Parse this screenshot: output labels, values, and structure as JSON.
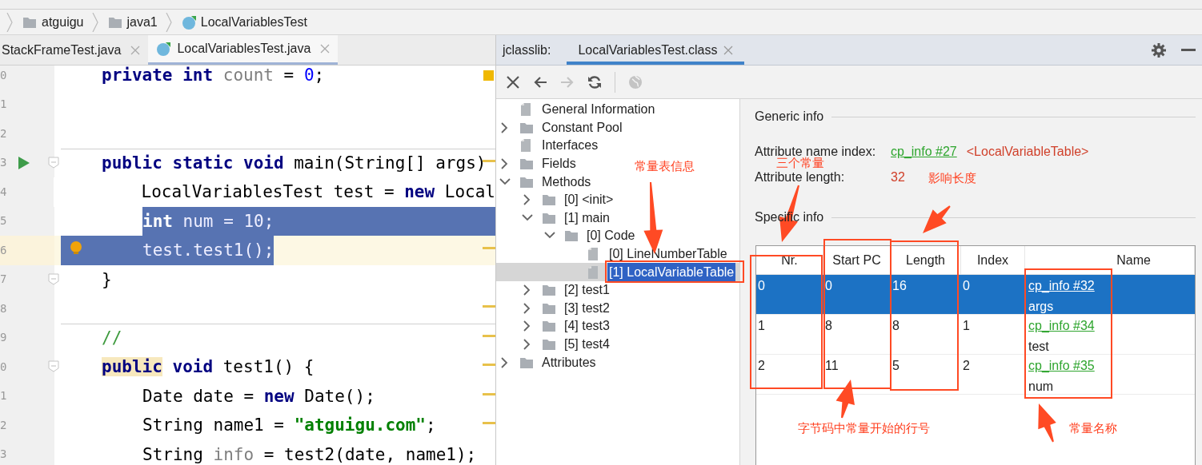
{
  "breadcrumbs": [
    {
      "label": "atguigu",
      "kind": "folder"
    },
    {
      "label": "java1",
      "kind": "folder"
    },
    {
      "label": "LocalVariablesTest",
      "kind": "class"
    }
  ],
  "editor_tabs": [
    {
      "label": "StackFrameTest.java",
      "selected": false
    },
    {
      "label": "LocalVariablesTest.java",
      "selected": true
    }
  ],
  "editor": {
    "lines": [
      {
        "number": "0",
        "kind": "top",
        "mark": false,
        "tokens": [
          {
            "text": "private",
            "kind": "kw"
          },
          {
            "text": " int",
            "kind": "kw"
          },
          {
            "text": " count",
            "kind": "field"
          },
          {
            "text": " = ",
            "kind": "plain"
          },
          {
            "text": "0",
            "kind": "num"
          },
          {
            "text": ";",
            "kind": "plain"
          }
        ]
      },
      {
        "number": "1",
        "kind": "blank",
        "mark": false
      },
      {
        "number": "2",
        "kind": "blank",
        "mark": false
      },
      {
        "number": "3",
        "kind": "top",
        "separator": true,
        "run": true,
        "fold": true,
        "mark": true,
        "tokens": [
          {
            "text": "public static void",
            "kind": "kw"
          },
          {
            "text": " main(String[] args)",
            "kind": "plain"
          }
        ]
      },
      {
        "number": "4",
        "kind": "inner",
        "mark": false,
        "tokens": [
          {
            "text": "LocalVariablesTest test = ",
            "kind": "plain"
          },
          {
            "text": "new",
            "kind": "kw"
          },
          {
            "text": " Local",
            "kind": "plain"
          }
        ]
      },
      {
        "number": "5",
        "kind": "inner",
        "selected": true,
        "mark": false,
        "tokens": [
          {
            "text": "int",
            "kind": "kw"
          },
          {
            "text": " num = ",
            "kind": "plain"
          },
          {
            "text": "10",
            "kind": "num"
          },
          {
            "text": ";",
            "kind": "plain"
          }
        ]
      },
      {
        "number": "6",
        "kind": "inner",
        "selected": true,
        "current": true,
        "bulb": true,
        "mark": true,
        "tokens": [
          {
            "text": "test.test1();",
            "kind": "plain"
          }
        ]
      },
      {
        "number": "7",
        "kind": "top",
        "fold": true,
        "mark": false,
        "tokens": [
          {
            "text": "}",
            "kind": "plain"
          }
        ]
      },
      {
        "number": "8",
        "kind": "blank",
        "mark": true
      },
      {
        "number": "9",
        "kind": "top",
        "separator": true,
        "mark": true,
        "tokens": [
          {
            "text": "//",
            "kind": "comment"
          }
        ]
      },
      {
        "number": "0",
        "kind": "top",
        "fold": true,
        "mark": true,
        "tokens": [
          {
            "text": "public",
            "kind": "kw",
            "marked": true
          },
          {
            "text": " void",
            "kind": "kw"
          },
          {
            "text": " test1() {",
            "kind": "plain"
          }
        ]
      },
      {
        "number": "1",
        "kind": "inner",
        "mark": true,
        "tokens": [
          {
            "text": "Date date = ",
            "kind": "plain"
          },
          {
            "text": "new",
            "kind": "kw"
          },
          {
            "text": " Date();",
            "kind": "plain"
          }
        ]
      },
      {
        "number": "2",
        "kind": "inner",
        "mark": true,
        "tokens": [
          {
            "text": "String name1 = ",
            "kind": "plain"
          },
          {
            "text": "\"atguigu.com\"",
            "kind": "str"
          },
          {
            "text": ";",
            "kind": "plain"
          }
        ]
      },
      {
        "number": "3",
        "kind": "inner",
        "mark": false,
        "tokens": [
          {
            "text": "String ",
            "kind": "plain"
          },
          {
            "text": "info",
            "kind": "field"
          },
          {
            "text": " = test2(date, name1);",
            "kind": "plain"
          }
        ]
      }
    ]
  },
  "tool_window": {
    "title": "jclasslib:",
    "tabs": [
      {
        "label": "LocalVariablesTest.class",
        "selected": true
      }
    ]
  },
  "toolbar": [
    {
      "kind": "close",
      "disabled": false
    },
    {
      "kind": "back",
      "disabled": false
    },
    {
      "kind": "forward",
      "disabled": true
    },
    {
      "kind": "refresh",
      "disabled": false
    },
    {
      "kind": "web",
      "disabled": true
    }
  ],
  "tree": [
    {
      "label": "General Information",
      "kind": "file",
      "selected": false
    },
    {
      "label": "Constant Pool",
      "kind": "folder",
      "expanded": false,
      "selected": false
    },
    {
      "label": "Interfaces",
      "kind": "file",
      "selected": false
    },
    {
      "label": "Fields",
      "kind": "folder",
      "expanded": false,
      "selected": false
    },
    {
      "label": "Methods",
      "kind": "folder",
      "expanded": true,
      "selected": false,
      "children": [
        {
          "label": "[0] <init>",
          "kind": "folder",
          "expanded": false,
          "selected": false
        },
        {
          "label": "[1] main",
          "kind": "folder",
          "expanded": true,
          "selected": false,
          "children": [
            {
              "label": "[0] Code",
              "kind": "folder",
              "expanded": true,
              "selected": false,
              "children": [
                {
                  "label": "[0] LineNumberTable",
                  "kind": "file",
                  "selected": false
                },
                {
                  "label": "[1] LocalVariableTable",
                  "kind": "file",
                  "selected": true
                }
              ]
            }
          ]
        },
        {
          "label": "[2] test1",
          "kind": "folder",
          "expanded": false,
          "selected": false
        },
        {
          "label": "[3] test2",
          "kind": "folder",
          "expanded": false,
          "selected": false
        },
        {
          "label": "[4] test3",
          "kind": "folder",
          "expanded": false,
          "selected": false
        },
        {
          "label": "[5] test4",
          "kind": "folder",
          "expanded": false,
          "selected": false
        }
      ]
    },
    {
      "label": "Attributes",
      "kind": "folder",
      "expanded": false,
      "selected": false
    }
  ],
  "details": {
    "generic_heading": "Generic info",
    "fields": [
      {
        "label": "Attribute name index:",
        "link": "cp_info #27",
        "value": "<LocalVariableTable>"
      },
      {
        "label": "Attribute length:",
        "value": "32"
      }
    ],
    "specific_heading": "Specific info",
    "table": {
      "columns": [
        "Nr.",
        "Start PC",
        "Length",
        "Index",
        "Name"
      ],
      "rows": [
        {
          "cells": [
            "0",
            "0",
            "16",
            "0"
          ],
          "name_link": "cp_info #32",
          "name": "args",
          "selected": true
        },
        {
          "cells": [
            "1",
            "8",
            "8",
            "1"
          ],
          "name_link": "cp_info #34",
          "name": "test",
          "selected": false
        },
        {
          "cells": [
            "2",
            "11",
            "5",
            "2"
          ],
          "name_link": "cp_info #35",
          "name": "num",
          "selected": false
        }
      ]
    }
  },
  "annotations": [
    {
      "text": "常量表信息"
    },
    {
      "text": "三个常量"
    },
    {
      "text": "影响长度"
    },
    {
      "text": "字节码中常量开始的行号"
    },
    {
      "text": "常量名称"
    }
  ]
}
